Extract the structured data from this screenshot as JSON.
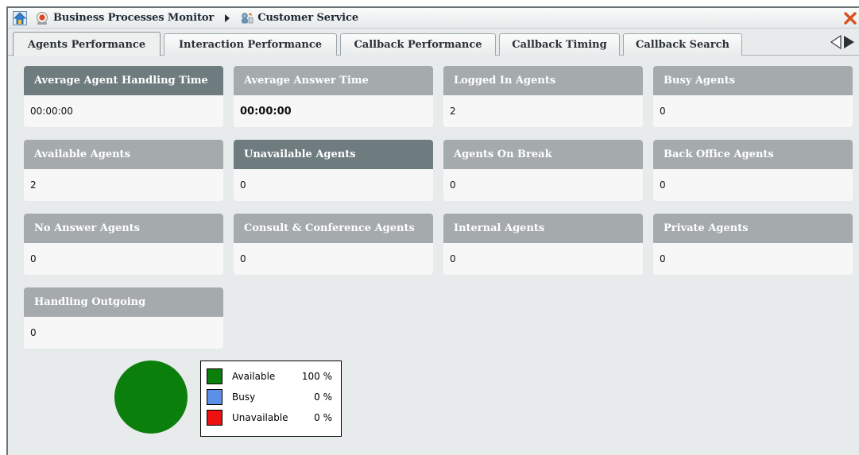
{
  "breadcrumb": {
    "root": "Business Processes Monitor",
    "current": "Customer Service"
  },
  "tabs": [
    {
      "label": "Agents Performance",
      "active": true
    },
    {
      "label": "Interaction Performance",
      "active": false
    },
    {
      "label": "Callback Performance",
      "active": false
    },
    {
      "label": "Callback Timing",
      "active": false
    },
    {
      "label": "Callback Search",
      "active": false
    }
  ],
  "cards": [
    {
      "title": "Average Agent Handling Time",
      "value": "00:00:00"
    },
    {
      "title": "Average Answer Time",
      "value": "00:00:00"
    },
    {
      "title": "Logged In Agents",
      "value": "2"
    },
    {
      "title": "Busy Agents",
      "value": "0"
    },
    {
      "title": "Available Agents",
      "value": "2"
    },
    {
      "title": "Unavailable Agents",
      "value": "0"
    },
    {
      "title": "Agents On Break",
      "value": "0"
    },
    {
      "title": "Back Office Agents",
      "value": "0"
    },
    {
      "title": "No Answer Agents",
      "value": "0"
    },
    {
      "title": "Consult & Conference Agents",
      "value": "0"
    },
    {
      "title": "Internal Agents",
      "value": "0"
    },
    {
      "title": "Private Agents",
      "value": "0"
    },
    {
      "title": "Handling Outgoing",
      "value": "0"
    }
  ],
  "legend": [
    {
      "label": "Available",
      "value": "100 %",
      "color": "#0b7f0b"
    },
    {
      "label": "Busy",
      "value": "0 %",
      "color": "#5b8fe8"
    },
    {
      "label": "Unavailable",
      "value": "0 %",
      "color": "#ee1111"
    }
  ],
  "chart_data": {
    "type": "pie",
    "categories": [
      "Available",
      "Busy",
      "Unavailable"
    ],
    "values": [
      100,
      0,
      0
    ],
    "colors": [
      "#0b7f0b",
      "#5b8fe8",
      "#ee1111"
    ]
  }
}
